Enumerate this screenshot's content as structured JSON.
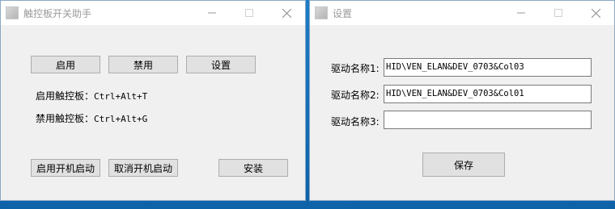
{
  "left_window": {
    "title": "触控板开关助手",
    "buttons": {
      "enable": "启用",
      "disable": "禁用",
      "settings": "设置",
      "enable_startup": "启用开机启动",
      "cancel_startup": "取消开机启动",
      "install": "安装"
    },
    "hotkeys": [
      {
        "label": "启用触控板：",
        "keys": "Ctrl+Alt+T"
      },
      {
        "label": "禁用触控板：",
        "keys": "Ctrl+Alt+G"
      }
    ]
  },
  "right_window": {
    "title": "设置",
    "fields": [
      {
        "label": "驱动名称1:",
        "value": "HID\\VEN_ELAN&DEV_0703&Col03"
      },
      {
        "label": "驱动名称2:",
        "value": "HID\\VEN_ELAN&DEV_0703&Col01"
      },
      {
        "label": "驱动名称3:",
        "value": ""
      }
    ],
    "save_label": "保存"
  },
  "icons": {
    "app": "app-icon",
    "minimize": "minimize-icon",
    "maximize": "maximize-icon",
    "close": "close-icon"
  }
}
